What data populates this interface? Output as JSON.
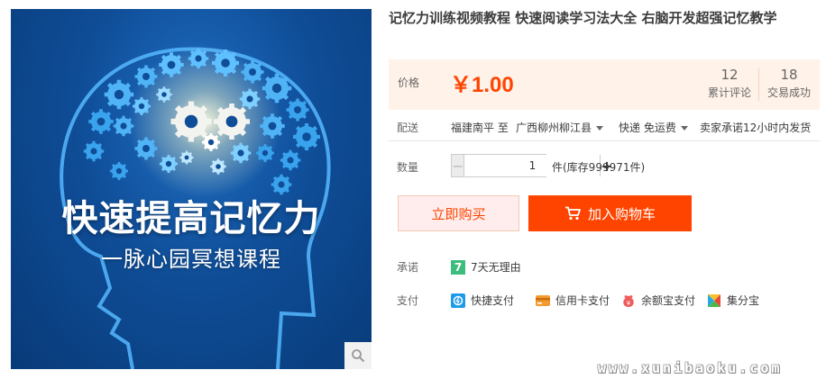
{
  "product": {
    "title": "记忆力训练视频教程 快速阅读学习法大全 右脑开发超强记忆教学",
    "image": {
      "title": "快速提高记忆力",
      "subtitle": "一脉心园冥想课程",
      "zoom_icon": "magnifier-icon"
    }
  },
  "price_panel": {
    "label": "价格",
    "price": "￥1.00",
    "reviews_count": "12",
    "reviews_label": "累计评论",
    "sales_count": "18",
    "sales_label": "交易成功"
  },
  "delivery": {
    "label": "配送",
    "from": "福建南平 至",
    "to": "广西柳州柳江县",
    "shipping": "快递 免运费",
    "promise": "卖家承诺12小时内发货"
  },
  "quantity": {
    "label": "数量",
    "value": "1",
    "stock": "件(库存999971件)"
  },
  "actions": {
    "buy_now": "立即购买",
    "add_to_cart": "加入购物车"
  },
  "promise": {
    "label": "承诺",
    "badge": "7",
    "text": "7天无理由"
  },
  "payment": {
    "label": "支付",
    "methods": [
      {
        "name": "快捷支付",
        "icon": "quick-pay-icon"
      },
      {
        "name": "信用卡支付",
        "icon": "credit-card-icon"
      },
      {
        "name": "余额宝支付",
        "icon": "yuebao-icon"
      },
      {
        "name": "集分宝",
        "icon": "jifenbao-icon"
      }
    ]
  },
  "watermark": "www.xunibaoku.com",
  "colors": {
    "accent": "#ff4400",
    "price_bg": "#fff2e8",
    "buy_bg": "#ffeded",
    "image_blue": "#0f4d97"
  }
}
